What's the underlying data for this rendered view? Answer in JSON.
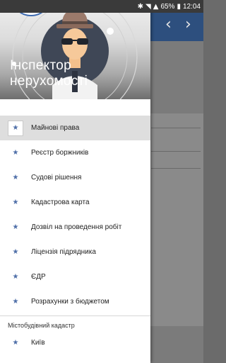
{
  "status_bar": {
    "battery": "65%",
    "time": "12:04"
  },
  "header": {
    "title": "Інспектор нерухомості"
  },
  "menu": {
    "items": [
      {
        "label": "Майнові права",
        "icon": "star-icon",
        "selected": true
      },
      {
        "label": "Реєстр боржників",
        "icon": "star-icon"
      },
      {
        "label": "Судові рішення",
        "icon": "star-icon"
      },
      {
        "label": "Кадастрова карта",
        "icon": "star-icon"
      },
      {
        "label": "Дозвіл на проведення робіт",
        "icon": "star-icon"
      },
      {
        "label": "Ліцензія підрядника",
        "icon": "star-icon"
      },
      {
        "label": "ЄДР",
        "icon": "star-icon"
      },
      {
        "label": "Розрахунки з бюджетом",
        "icon": "star-icon"
      }
    ],
    "section_title": "Містобудівний кадастр",
    "section_items": [
      {
        "label": "Київ",
        "icon": "star-icon"
      }
    ]
  },
  "colors": {
    "accent": "#4f6fa8",
    "toolbar": "#2d4f7e",
    "selected_bg": "#dedede"
  }
}
